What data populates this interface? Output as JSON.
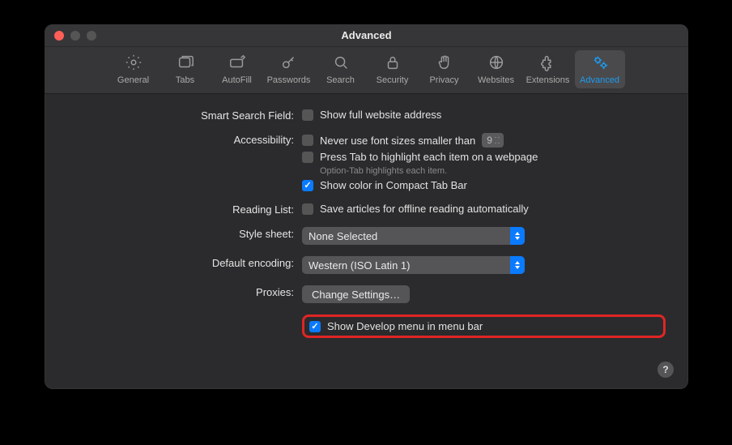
{
  "window": {
    "title": "Advanced"
  },
  "toolbar": {
    "items": [
      {
        "label": "General"
      },
      {
        "label": "Tabs"
      },
      {
        "label": "AutoFill"
      },
      {
        "label": "Passwords"
      },
      {
        "label": "Search"
      },
      {
        "label": "Security"
      },
      {
        "label": "Privacy"
      },
      {
        "label": "Websites"
      },
      {
        "label": "Extensions"
      },
      {
        "label": "Advanced"
      }
    ],
    "selected_index": 9
  },
  "sections": {
    "smart_search": {
      "label": "Smart Search Field:",
      "show_full_address": {
        "text": "Show full website address",
        "checked": false
      }
    },
    "accessibility": {
      "label": "Accessibility:",
      "min_font": {
        "text": "Never use font sizes smaller than",
        "checked": false,
        "value": "9"
      },
      "press_tab": {
        "text": "Press Tab to highlight each item on a webpage",
        "checked": false,
        "hint": "Option-Tab highlights each item."
      },
      "compact_color": {
        "text": "Show color in Compact Tab Bar",
        "checked": true
      }
    },
    "reading_list": {
      "label": "Reading List:",
      "save_offline": {
        "text": "Save articles for offline reading automatically",
        "checked": false
      }
    },
    "style_sheet": {
      "label": "Style sheet:",
      "value": "None Selected"
    },
    "default_encoding": {
      "label": "Default encoding:",
      "value": "Western (ISO Latin 1)"
    },
    "proxies": {
      "label": "Proxies:",
      "button": "Change Settings…"
    },
    "develop": {
      "text": "Show Develop menu in menu bar",
      "checked": true
    }
  },
  "help_label": "?"
}
